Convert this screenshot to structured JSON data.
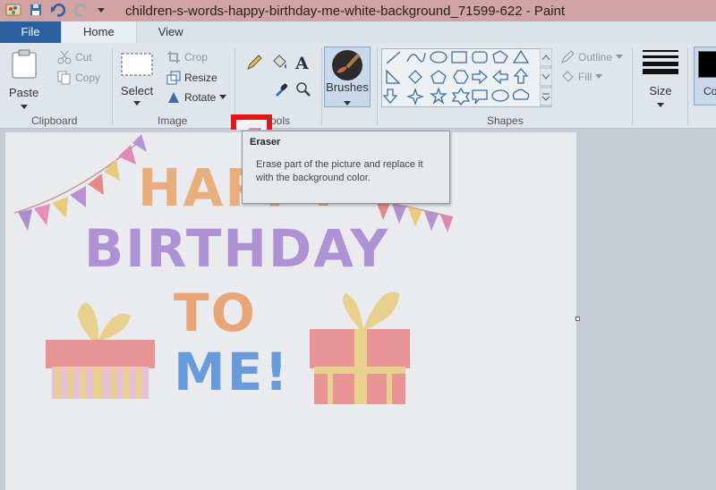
{
  "window": {
    "title": "children-s-words-happy-birthday-me-white-background_71599-622 - Paint"
  },
  "tabs": [
    {
      "label": "File"
    },
    {
      "label": "Home"
    },
    {
      "label": "View"
    }
  ],
  "clipboard": {
    "paste_label": "Paste",
    "cut_label": "Cut",
    "copy_label": "Copy",
    "group_label": "Clipboard"
  },
  "image": {
    "select_label": "Select",
    "crop_label": "Crop",
    "resize_label": "Resize",
    "rotate_label": "Rotate",
    "group_label": "Image"
  },
  "tools": {
    "group_label": "Tools",
    "brushes_label": "Brushes"
  },
  "shapes": {
    "outline_label": "Outline",
    "fill_label": "Fill",
    "group_label": "Shapes"
  },
  "size": {
    "label": "Size"
  },
  "colors": {
    "label": "Co"
  },
  "tooltip": {
    "title": "Eraser",
    "description": "Erase part of the picture and replace it with the background color."
  },
  "artwork": {
    "line1": "HAPPY",
    "line2": "BIRTHDAY",
    "line3": "TO",
    "line4": "ME!"
  },
  "accent": {
    "highlight": "#e8141a",
    "file_tab": "#2a5fa0"
  }
}
